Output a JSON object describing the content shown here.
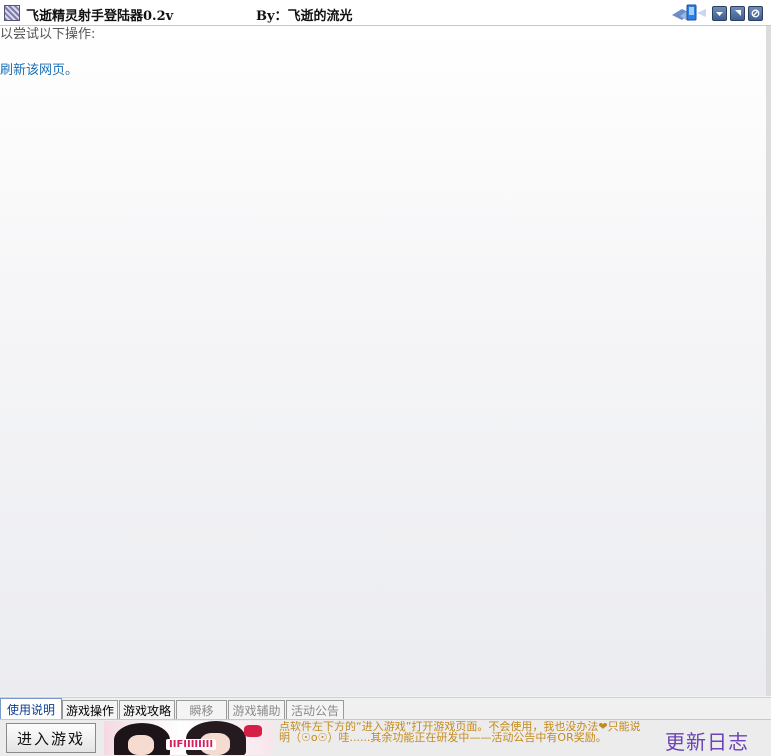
{
  "window": {
    "title": "飞逝精灵射手登陆器0.2v",
    "author": "By：飞逝的流光"
  },
  "content": {
    "hint": "以尝试以下操作:",
    "refresh_link": "刷新该网页。"
  },
  "tabs": [
    {
      "label": "使用说明",
      "state": "active"
    },
    {
      "label": "游戏操作",
      "state": "normal"
    },
    {
      "label": "游戏攻略",
      "state": "normal"
    },
    {
      "label": "瞬移",
      "state": "disabled"
    },
    {
      "label": "游戏辅助",
      "state": "disabled"
    },
    {
      "label": "活动公告",
      "state": "disabled"
    }
  ],
  "bottom": {
    "enter_button": "进入游戏",
    "banner_text": "IIFIIIIIIII",
    "notice": "点软件左下方的“进入游戏”打开游戏页面。不会使用，我也没办法❤只能说明（☉o☉）哇......其余功能正在研发中——活动公告中有OR奖励。",
    "changelog": "更新日志"
  },
  "colors": {
    "link": "#1a6fb6",
    "notice": "#c48a1e",
    "changelog": "#6b43b5",
    "active_tab": "#0b3d91"
  }
}
